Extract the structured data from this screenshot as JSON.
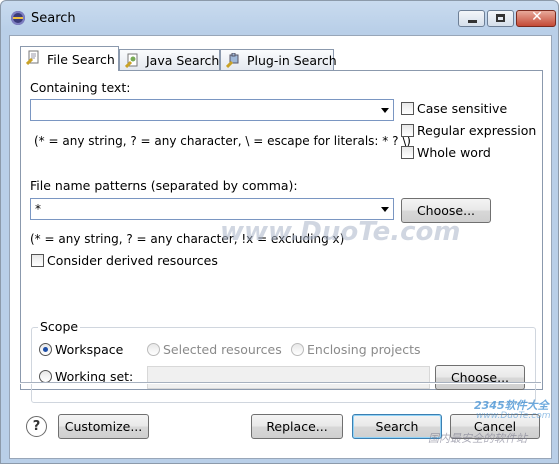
{
  "window": {
    "title": "Search"
  },
  "tabs": [
    {
      "label": "File Search",
      "icon": "file-search-icon"
    },
    {
      "label": "Java Search",
      "icon": "java-search-icon"
    },
    {
      "label": "Plug-in Search",
      "icon": "plugin-search-icon"
    }
  ],
  "containing_text": {
    "label": "Containing text:",
    "value": "",
    "hint": "(* = any string, ? = any character, \\ = escape for literals: * ? \\)",
    "options": {
      "case_sensitive": {
        "label": "Case sensitive",
        "checked": false
      },
      "regex": {
        "label": "Regular expression",
        "checked": false
      },
      "whole_word": {
        "label": "Whole word",
        "checked": false
      }
    }
  },
  "file_name": {
    "label": "File name patterns (separated by comma):",
    "value": "*",
    "choose_label": "Choose...",
    "hint": "(* = any string, ? = any character, !x = excluding x)"
  },
  "derived": {
    "label": "Consider derived resources",
    "checked": false
  },
  "scope": {
    "legend": "Scope",
    "workspace": {
      "label": "Workspace",
      "selected": true
    },
    "selected_resources": {
      "label": "Selected resources",
      "enabled": false
    },
    "enclosing_projects": {
      "label": "Enclosing projects",
      "enabled": false
    },
    "working_set": {
      "label": "Working set:",
      "value": ""
    },
    "choose_label": "Choose..."
  },
  "footer": {
    "help_label": "?",
    "customize_label": "Customize...",
    "replace_label": "Replace...",
    "search_label": "Search",
    "cancel_label": "Cancel"
  },
  "watermarks": {
    "quote": "www.DuoTe.com",
    "site": "2345软件大全",
    "url": "www.DuoTe.com",
    "slogan": "国内最安全的软件站"
  },
  "colors": {
    "title_bar": "#b9cfe8",
    "default_button_border": "#3c7fb1",
    "radio_dot": "#1e4fa8"
  }
}
